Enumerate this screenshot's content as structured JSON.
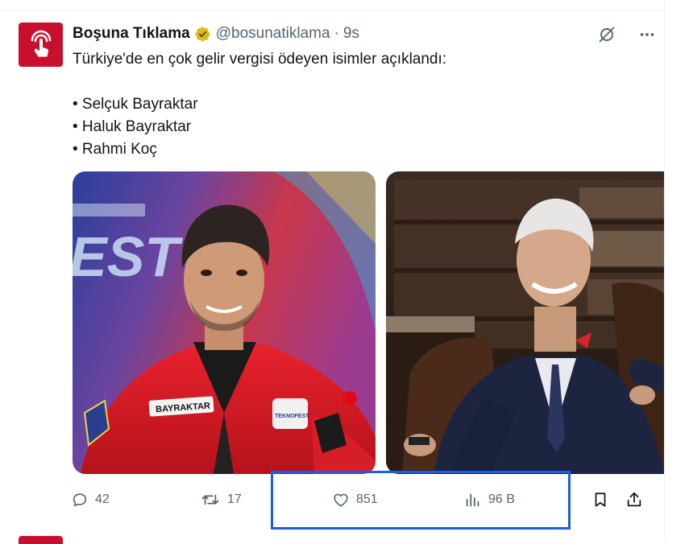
{
  "tweet": {
    "display_name": "Boşuna Tıklama",
    "handle": "@bosunatiklama",
    "separator": "·",
    "time": "9s",
    "text_lines": [
      "Türkiye'de en çok gelir vergisi ödeyen isimler açıklandı:",
      "",
      "• Selçuk Bayraktar",
      "• Haluk Bayraktar",
      "• Rahmi Koç"
    ],
    "images": [
      {
        "subject": "Selçuk Bayraktar",
        "badge_text": "BAYRAKTAR",
        "backdrop_text": "EST",
        "patch_text": "TEKNOFEST"
      },
      {
        "subject": "Rahmi Koç"
      }
    ]
  },
  "actions": {
    "replies": "42",
    "reposts": "17",
    "likes": "851",
    "views": "96 B"
  },
  "colors": {
    "muted": "#536471",
    "text": "#0f1419",
    "verified": "#e2b719",
    "brand": "#c8102e",
    "highlight": "#1a5ee6"
  },
  "icons": [
    "hand-tap-logo-icon",
    "verified-badge-icon",
    "grok-icon",
    "more-icon",
    "reply-icon",
    "repost-icon",
    "like-icon",
    "views-icon",
    "bookmark-icon",
    "share-icon"
  ]
}
